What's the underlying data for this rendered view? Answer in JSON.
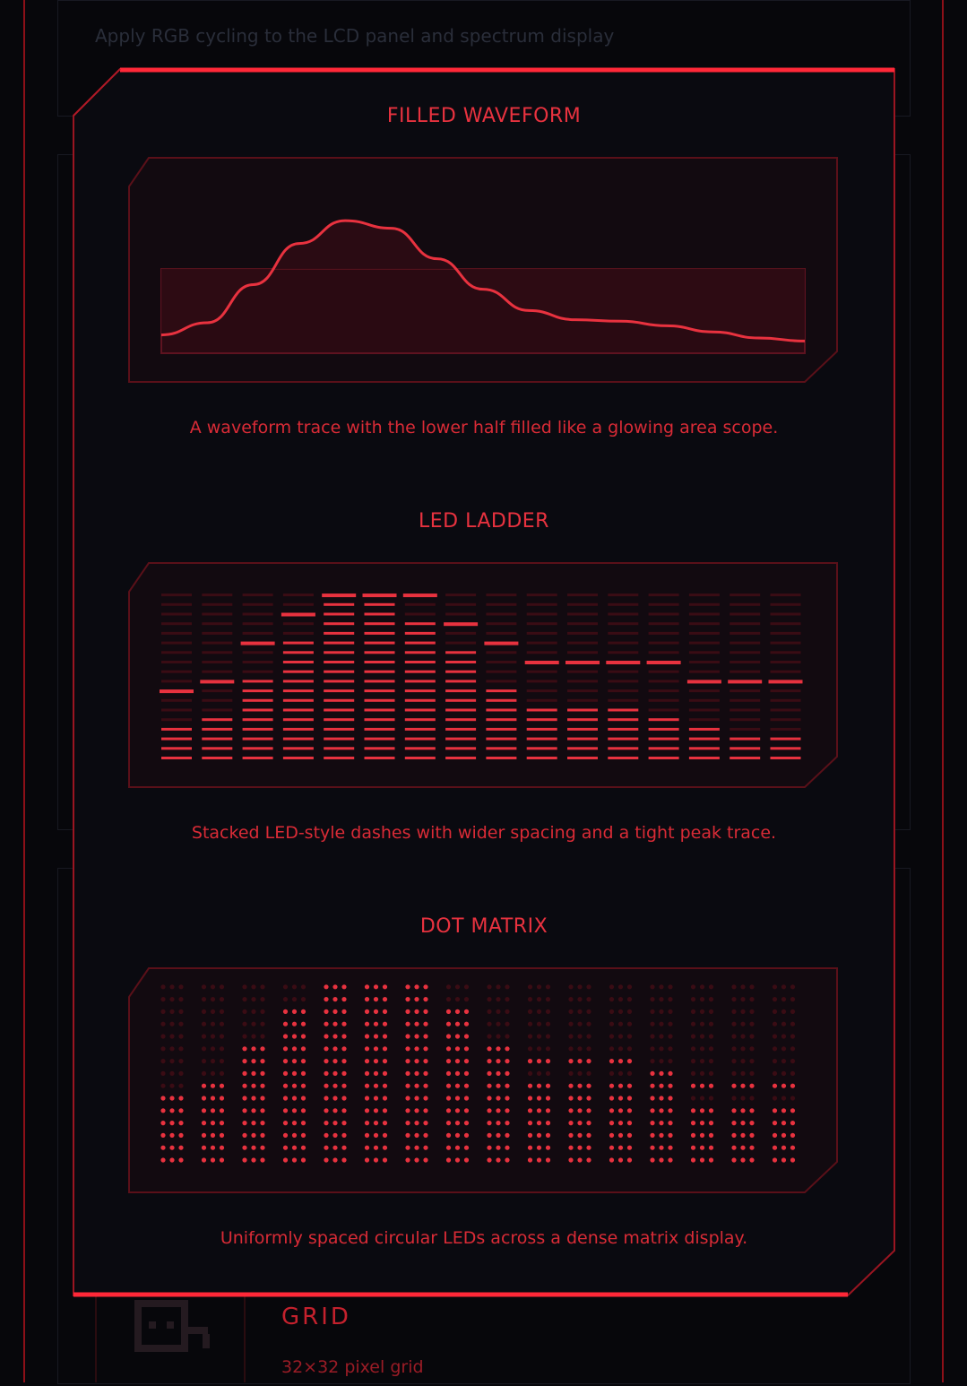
{
  "background": {
    "top_text": "Apply RGB cycling to the LCD panel and spectrum display",
    "grid_label": "GRID",
    "grid_sub": "32×32 pixel grid"
  },
  "sections": [
    {
      "title": "FILLED WAVEFORM",
      "caption": "A waveform trace with the lower half filled like a glowing area scope."
    },
    {
      "title": "LED LADDER",
      "caption": "Stacked LED-style dashes with wider spacing and a tight peak trace."
    },
    {
      "title": "DOT MATRIX",
      "caption": "Uniformly spaced circular LEDs across a dense matrix display."
    }
  ],
  "visuals": {
    "waveform_levels": [
      0.12,
      0.2,
      0.45,
      0.72,
      0.87,
      0.82,
      0.62,
      0.42,
      0.28,
      0.22,
      0.21,
      0.18,
      0.14,
      0.1,
      0.08
    ],
    "ladder_bars": [
      {
        "level": 4,
        "peak": 7
      },
      {
        "level": 5,
        "peak": 8
      },
      {
        "level": 9,
        "peak": 12
      },
      {
        "level": 13,
        "peak": 15
      },
      {
        "level": 17,
        "peak": 17
      },
      {
        "level": 17,
        "peak": 17
      },
      {
        "level": 15,
        "peak": 17
      },
      {
        "level": 12,
        "peak": 14
      },
      {
        "level": 8,
        "peak": 12
      },
      {
        "level": 6,
        "peak": 10
      },
      {
        "level": 6,
        "peak": 10
      },
      {
        "level": 6,
        "peak": 10
      },
      {
        "level": 5,
        "peak": 10
      },
      {
        "level": 4,
        "peak": 8
      },
      {
        "level": 3,
        "peak": 8
      },
      {
        "level": 3,
        "peak": 8
      }
    ],
    "matrix_bars": [
      {
        "level": 6,
        "peak": 6
      },
      {
        "level": 7,
        "peak": 7
      },
      {
        "level": 10,
        "peak": 10
      },
      {
        "level": 13,
        "peak": 13
      },
      {
        "level": 15,
        "peak": 15
      },
      {
        "level": 15,
        "peak": 15
      },
      {
        "level": 15,
        "peak": 15
      },
      {
        "level": 12,
        "peak": 13
      },
      {
        "level": 10,
        "peak": 10
      },
      {
        "level": 7,
        "peak": 9
      },
      {
        "level": 7,
        "peak": 9
      },
      {
        "level": 7,
        "peak": 9
      },
      {
        "level": 7,
        "peak": 8
      },
      {
        "level": 5,
        "peak": 7
      },
      {
        "level": 5,
        "peak": 7
      },
      {
        "level": 5,
        "peak": 7
      }
    ],
    "accent": "#e8323f",
    "accent_dim": "#5e0f18"
  }
}
